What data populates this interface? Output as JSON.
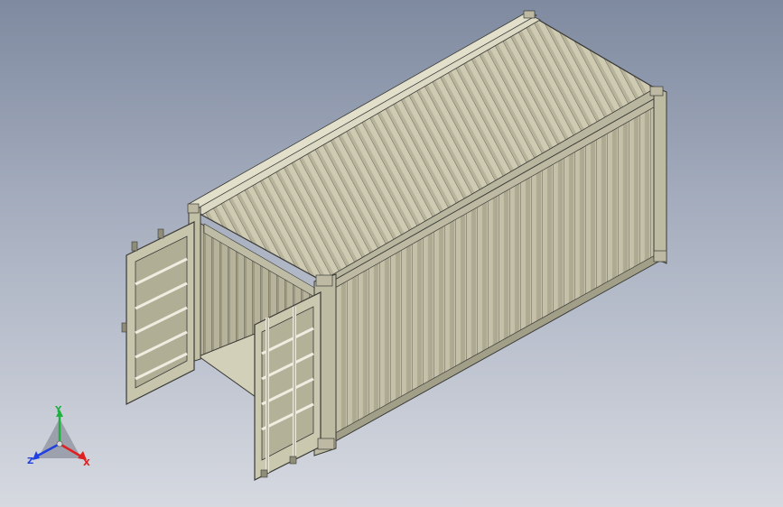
{
  "window": {
    "title": ""
  },
  "colors": {
    "background_top": "#7f8aa0",
    "background_bottom": "#d6d9e0",
    "container_face": "#c9c6ad",
    "container_shade": "#a9a68e",
    "container_dark": "#8c8a76",
    "edge_lines": "#3a3a36",
    "axis_x": "#e02020",
    "axis_y": "#20b040",
    "axis_z": "#2040e0"
  },
  "model": {
    "name": "",
    "parts": [
      "container-body",
      "roof-panel",
      "side-wall",
      "door-frame",
      "left-door",
      "right-door",
      "floor"
    ]
  },
  "triad": {
    "x_label": "X",
    "y_label": "Y",
    "z_label": "Z",
    "icon": "coordinate-triad-icon"
  }
}
